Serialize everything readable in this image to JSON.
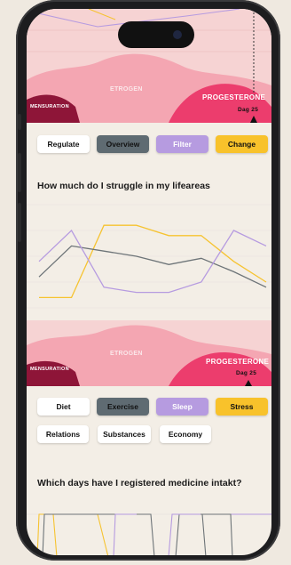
{
  "top_cycle": {
    "left_label": "MENSURATION",
    "middle_label": "ETROGEN",
    "right_label": "PROGESTERONE",
    "day_label": "Dag 25"
  },
  "buttons_top": [
    {
      "label": "Regulate",
      "bg": "#ffffff",
      "fg": "#111111"
    },
    {
      "label": "Overview",
      "bg": "#5f6b72",
      "fg": "#111111"
    },
    {
      "label": "Filter",
      "bg": "#b69be0",
      "fg": "#ffffff"
    },
    {
      "label": "Change",
      "bg": "#f8c22b",
      "fg": "#111111"
    }
  ],
  "question1": "How much do I struggle in my lifeareas",
  "chart_data": {
    "type": "line",
    "x": [
      1,
      2,
      3,
      4,
      5,
      6,
      7,
      8
    ],
    "ylim": [
      0,
      10
    ],
    "grid": true,
    "series": [
      {
        "color": "#f6c330",
        "values": [
          1,
          1,
          8,
          8,
          7,
          7,
          4.5,
          2.5
        ]
      },
      {
        "color": "#6d7478",
        "values": [
          3,
          6,
          5.5,
          5,
          4.2,
          4.8,
          3.5,
          2
        ]
      },
      {
        "color": "#b69be0",
        "values": [
          4.5,
          7.5,
          2,
          1.5,
          1.5,
          2.5,
          7.5,
          6
        ]
      }
    ]
  },
  "bottom_cycle": {
    "left_label": "MENSURATION",
    "middle_label": "ETROGEN",
    "right_label": "PROGESTERONE",
    "day_label": "Dag 25"
  },
  "buttons_mid": [
    {
      "label": "Diet",
      "bg": "#ffffff",
      "fg": "#111111"
    },
    {
      "label": "Exercise",
      "bg": "#5f6b72",
      "fg": "#111111"
    },
    {
      "label": "Sleep",
      "bg": "#b69be0",
      "fg": "#ffffff"
    },
    {
      "label": "Stress",
      "bg": "#f8c22b",
      "fg": "#111111"
    }
  ],
  "buttons_extra": [
    {
      "label": "Relations"
    },
    {
      "label": "Substances"
    },
    {
      "label": "Economy"
    }
  ],
  "question2": "Which days have I registered medicine intakt?"
}
